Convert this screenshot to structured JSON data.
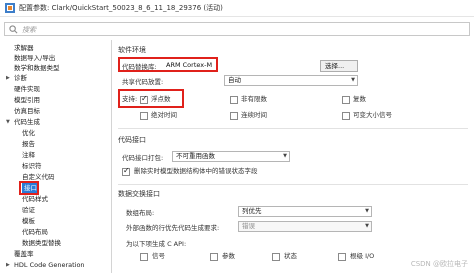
{
  "window": {
    "title": "配置参数: Clark/QuickStart_50023_8_6_11_18_29376 (活动)"
  },
  "search": {
    "placeholder": "搜索"
  },
  "sidebar": {
    "items": [
      {
        "label": "求解器"
      },
      {
        "label": "数据导入/导出"
      },
      {
        "label": "数学和数据类型"
      },
      {
        "label": "诊断"
      },
      {
        "label": "硬件实现"
      },
      {
        "label": "模型引用"
      },
      {
        "label": "仿真目标"
      },
      {
        "label": "代码生成"
      },
      {
        "label": "优化"
      },
      {
        "label": "报告"
      },
      {
        "label": "注释"
      },
      {
        "label": "标识符"
      },
      {
        "label": "自定义代码"
      },
      {
        "label": "接口"
      },
      {
        "label": "代码样式"
      },
      {
        "label": "验证"
      },
      {
        "label": "模板"
      },
      {
        "label": "代码布局"
      },
      {
        "label": "数据类型替换"
      },
      {
        "label": "覆盖率"
      },
      {
        "label": "HDL Code Generation"
      }
    ]
  },
  "software_env": {
    "section_title": "软件环境",
    "code_lib_label": "代码替换库:",
    "code_lib_value": "ARM Cortex-M",
    "select_button": "选择...",
    "shared_code_label": "共享代码放置:",
    "shared_code_value": "自动",
    "support_label": "支持:",
    "options": [
      {
        "label": "浮点数",
        "checked": true
      },
      {
        "label": "非有限数",
        "checked": false
      },
      {
        "label": "复数",
        "checked": false
      },
      {
        "label": "绝对时间",
        "checked": false
      },
      {
        "label": "连续时间",
        "checked": false
      },
      {
        "label": "可变大小信号",
        "checked": false
      }
    ]
  },
  "code_interface": {
    "section_title": "代码接口",
    "packaging_label": "代码接口打包:",
    "packaging_value": "不可重用函数",
    "remove_error_label": "删除实时模型数据结构体中的错误状态字段",
    "remove_error_checked": true
  },
  "data_exchange": {
    "section_title": "数据交换接口",
    "array_layout_label": "数组布局:",
    "array_layout_value": "列优先",
    "external_func_label": "外部函数的行优先代码生成要求:",
    "external_func_value": "错误",
    "c_api_label": "为以下项生成 C API:",
    "c_api_options": [
      {
        "label": "信号",
        "checked": false
      },
      {
        "label": "参数",
        "checked": false
      },
      {
        "label": "状态",
        "checked": false
      },
      {
        "label": "根级 I/O",
        "checked": false
      }
    ]
  },
  "watermark": "CSDN @欧拉电子",
  "colors": {
    "highlight": "#e0211b",
    "selection": "#2a7bd6"
  }
}
